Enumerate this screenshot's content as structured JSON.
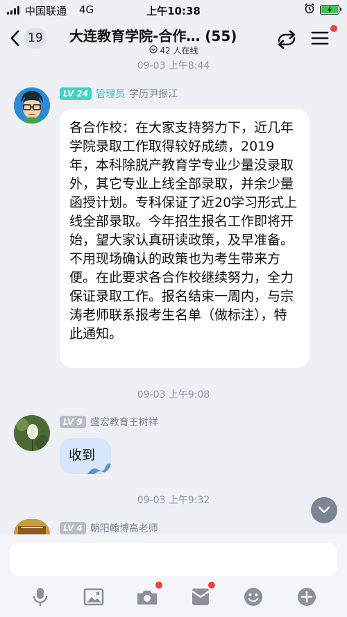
{
  "status_bar": {
    "carrier": "中国联通",
    "network": "4G",
    "time": "上午10:38",
    "battery_color": "#3cc34a"
  },
  "header": {
    "back_count": "19",
    "title": "大连教育学院-合作…  (55)",
    "online": "42 人在线",
    "icons": [
      "chevron-left-icon",
      "switch-icon",
      "menu-icon"
    ]
  },
  "messages": [
    {
      "timestamp": "09-03 上午8:44",
      "level": "LV 24",
      "role": "管理员",
      "sender": "学历尹振江",
      "text": "各合作校：在大家支持努力下，近几年学院录取工作取得较好成绩，2019年，本科除脱产教育学专业少量没录取外，其它专业上线全部录取，并余少量函授计划。专科保证了近20学习形式上线全部录取。今年招生报名工作即将开始，望大家认真研读政策，及早准备。不用现场确认的政策也为考生带来方便。在此要求各合作校继续努力，全力保证录取工作。报名结束一周内，与宗涛老师联系报考生名单（做标注），特此通知。"
    },
    {
      "timestamp": "09-03 上午9:08",
      "level": "LV 9",
      "sender": "盛宏教育王树祥",
      "text": "收到"
    },
    {
      "timestamp": "09-03 上午9:32",
      "level": "LV 4",
      "sender": "朝阳翰博高老师"
    }
  ],
  "toolbar": {
    "icons": [
      "microphone-icon",
      "image-icon",
      "camera-icon",
      "red-packet-icon",
      "emoji-icon",
      "plus-icon"
    ]
  },
  "colors": {
    "background": "#eef0f5",
    "accent_teal": "#36c3b8",
    "notification_red": "#f0443a"
  }
}
